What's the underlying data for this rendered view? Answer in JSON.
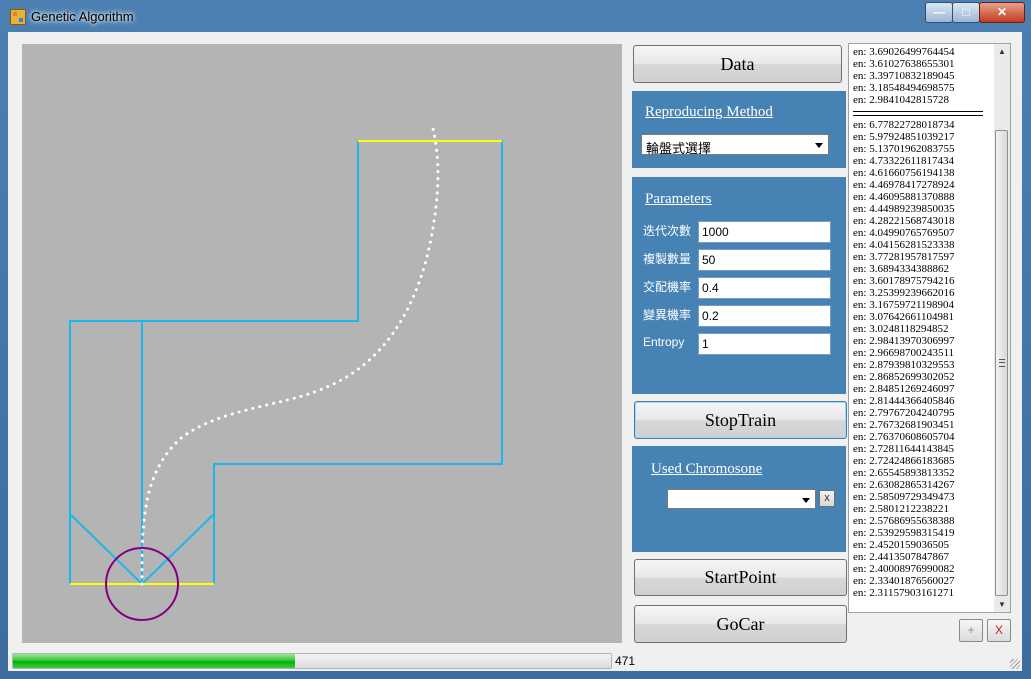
{
  "window": {
    "title": "Genetic Algorithm",
    "controls": {
      "minimize": "—",
      "maximize": "□",
      "close": "✕"
    }
  },
  "colors": {
    "panel": "#4682b4",
    "track_wall": "#1ab8ea",
    "finish_line": "#ffff00",
    "car": "#800080",
    "path": "#ffffff",
    "canvas": "#b4b4b4"
  },
  "buttons": {
    "data": "Data",
    "stop_train": "StopTrain",
    "start_point": "StartPoint",
    "go_car": "GoCar",
    "add": "+",
    "remove": "X",
    "clear_chromosome": "x"
  },
  "reproducing": {
    "label": "Reproducing Method",
    "selected": "輪盤式選擇"
  },
  "parameters": {
    "label": "Parameters",
    "fields": [
      {
        "label": "迭代次數",
        "value": "1000"
      },
      {
        "label": "複製數量",
        "value": "50"
      },
      {
        "label": "交配機率",
        "value": "0.4"
      },
      {
        "label": "變異機率",
        "value": "0.2"
      },
      {
        "label": "Entropy",
        "value": "1"
      }
    ]
  },
  "chromosome": {
    "label": "Used Chromosone",
    "selected": ""
  },
  "log": {
    "top": [
      "en: 3.69026499764454",
      "en: 3.61027638655301",
      "en: 3.39710832189045",
      "en: 3.18548494698575",
      "en: 2.9841042815728"
    ],
    "bottom": [
      "en: 6.77822728018734",
      "en: 5.97924851039217",
      "en: 5.13701962083755",
      "en: 4.73322611817434",
      "en: 4.61660756194138",
      "en: 4.46978417278924",
      "en: 4.46095881370888",
      "en: 4.44989239850035",
      "en: 4.28221568743018",
      "en: 4.04990765769507",
      "en: 4.04156281523338",
      "en: 3.77281957817597",
      "en: 3.6894334388862",
      "en: 3.60178975794216",
      "en: 3.25399239662016",
      "en: 3.16759721198904",
      "en: 3.07642661104981",
      "en: 3.0248118294852",
      "en: 2.98413970306997",
      "en: 2.96698700243511",
      "en: 2.87939810329553",
      "en: 2.86852699302052",
      "en: 2.84851269246097",
      "en: 2.81444366405846",
      "en: 2.79767204240795",
      "en: 2.76732681903451",
      "en: 2.76370608605704",
      "en: 2.72811644143845",
      "en: 2.72424866183685",
      "en: 2.65545893813352",
      "en: 2.63082865314267",
      "en: 2.58509729349473",
      "en: 2.5801212238221",
      "en: 2.57686955638388",
      "en: 2.53929598315419",
      "en: 2.4520159036505",
      "en: 2.4413507847867",
      "en: 2.40008976990082",
      "en: 2.33401876560027",
      "en: 2.31157903161271"
    ]
  },
  "progress": {
    "value": 471,
    "max": 1000,
    "label": "471"
  }
}
